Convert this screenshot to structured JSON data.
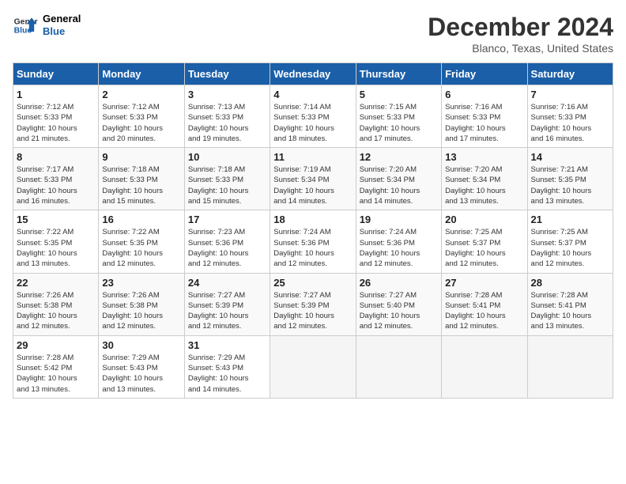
{
  "logo": {
    "line1": "General",
    "line2": "Blue"
  },
  "title": "December 2024",
  "subtitle": "Blanco, Texas, United States",
  "days_of_week": [
    "Sunday",
    "Monday",
    "Tuesday",
    "Wednesday",
    "Thursday",
    "Friday",
    "Saturday"
  ],
  "weeks": [
    [
      {
        "day": "1",
        "info": "Sunrise: 7:12 AM\nSunset: 5:33 PM\nDaylight: 10 hours\nand 21 minutes."
      },
      {
        "day": "2",
        "info": "Sunrise: 7:12 AM\nSunset: 5:33 PM\nDaylight: 10 hours\nand 20 minutes."
      },
      {
        "day": "3",
        "info": "Sunrise: 7:13 AM\nSunset: 5:33 PM\nDaylight: 10 hours\nand 19 minutes."
      },
      {
        "day": "4",
        "info": "Sunrise: 7:14 AM\nSunset: 5:33 PM\nDaylight: 10 hours\nand 18 minutes."
      },
      {
        "day": "5",
        "info": "Sunrise: 7:15 AM\nSunset: 5:33 PM\nDaylight: 10 hours\nand 17 minutes."
      },
      {
        "day": "6",
        "info": "Sunrise: 7:16 AM\nSunset: 5:33 PM\nDaylight: 10 hours\nand 17 minutes."
      },
      {
        "day": "7",
        "info": "Sunrise: 7:16 AM\nSunset: 5:33 PM\nDaylight: 10 hours\nand 16 minutes."
      }
    ],
    [
      {
        "day": "8",
        "info": "Sunrise: 7:17 AM\nSunset: 5:33 PM\nDaylight: 10 hours\nand 16 minutes."
      },
      {
        "day": "9",
        "info": "Sunrise: 7:18 AM\nSunset: 5:33 PM\nDaylight: 10 hours\nand 15 minutes."
      },
      {
        "day": "10",
        "info": "Sunrise: 7:18 AM\nSunset: 5:33 PM\nDaylight: 10 hours\nand 15 minutes."
      },
      {
        "day": "11",
        "info": "Sunrise: 7:19 AM\nSunset: 5:34 PM\nDaylight: 10 hours\nand 14 minutes."
      },
      {
        "day": "12",
        "info": "Sunrise: 7:20 AM\nSunset: 5:34 PM\nDaylight: 10 hours\nand 14 minutes."
      },
      {
        "day": "13",
        "info": "Sunrise: 7:20 AM\nSunset: 5:34 PM\nDaylight: 10 hours\nand 13 minutes."
      },
      {
        "day": "14",
        "info": "Sunrise: 7:21 AM\nSunset: 5:35 PM\nDaylight: 10 hours\nand 13 minutes."
      }
    ],
    [
      {
        "day": "15",
        "info": "Sunrise: 7:22 AM\nSunset: 5:35 PM\nDaylight: 10 hours\nand 13 minutes."
      },
      {
        "day": "16",
        "info": "Sunrise: 7:22 AM\nSunset: 5:35 PM\nDaylight: 10 hours\nand 12 minutes."
      },
      {
        "day": "17",
        "info": "Sunrise: 7:23 AM\nSunset: 5:36 PM\nDaylight: 10 hours\nand 12 minutes."
      },
      {
        "day": "18",
        "info": "Sunrise: 7:24 AM\nSunset: 5:36 PM\nDaylight: 10 hours\nand 12 minutes."
      },
      {
        "day": "19",
        "info": "Sunrise: 7:24 AM\nSunset: 5:36 PM\nDaylight: 10 hours\nand 12 minutes."
      },
      {
        "day": "20",
        "info": "Sunrise: 7:25 AM\nSunset: 5:37 PM\nDaylight: 10 hours\nand 12 minutes."
      },
      {
        "day": "21",
        "info": "Sunrise: 7:25 AM\nSunset: 5:37 PM\nDaylight: 10 hours\nand 12 minutes."
      }
    ],
    [
      {
        "day": "22",
        "info": "Sunrise: 7:26 AM\nSunset: 5:38 PM\nDaylight: 10 hours\nand 12 minutes."
      },
      {
        "day": "23",
        "info": "Sunrise: 7:26 AM\nSunset: 5:38 PM\nDaylight: 10 hours\nand 12 minutes."
      },
      {
        "day": "24",
        "info": "Sunrise: 7:27 AM\nSunset: 5:39 PM\nDaylight: 10 hours\nand 12 minutes."
      },
      {
        "day": "25",
        "info": "Sunrise: 7:27 AM\nSunset: 5:39 PM\nDaylight: 10 hours\nand 12 minutes."
      },
      {
        "day": "26",
        "info": "Sunrise: 7:27 AM\nSunset: 5:40 PM\nDaylight: 10 hours\nand 12 minutes."
      },
      {
        "day": "27",
        "info": "Sunrise: 7:28 AM\nSunset: 5:41 PM\nDaylight: 10 hours\nand 12 minutes."
      },
      {
        "day": "28",
        "info": "Sunrise: 7:28 AM\nSunset: 5:41 PM\nDaylight: 10 hours\nand 13 minutes."
      }
    ],
    [
      {
        "day": "29",
        "info": "Sunrise: 7:28 AM\nSunset: 5:42 PM\nDaylight: 10 hours\nand 13 minutes."
      },
      {
        "day": "30",
        "info": "Sunrise: 7:29 AM\nSunset: 5:43 PM\nDaylight: 10 hours\nand 13 minutes."
      },
      {
        "day": "31",
        "info": "Sunrise: 7:29 AM\nSunset: 5:43 PM\nDaylight: 10 hours\nand 14 minutes."
      },
      null,
      null,
      null,
      null
    ]
  ]
}
